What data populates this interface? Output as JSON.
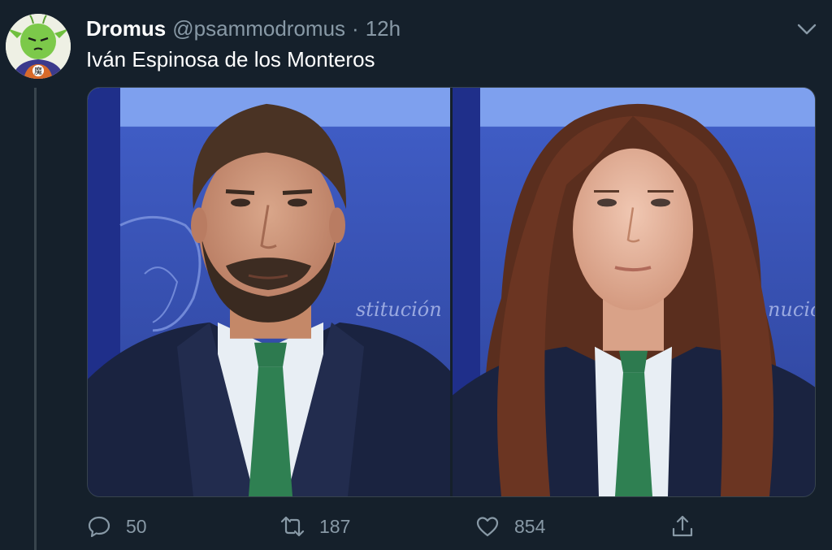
{
  "tweet": {
    "display_name": "Dromus",
    "handle": "@psammodromus",
    "separator": "·",
    "time": "12h",
    "text": "Iván Espinosa de los Monteros"
  },
  "media": {
    "photos": [
      {
        "name": "original-photo"
      },
      {
        "name": "edited-photo"
      }
    ]
  },
  "actions": {
    "reply_count": "50",
    "retweet_count": "187",
    "like_count": "854"
  },
  "icons": {
    "reply": "speech-bubble-icon",
    "retweet": "retweet-icon",
    "like": "heart-icon",
    "share": "share-icon",
    "menu": "chevron-down-icon"
  },
  "colors": {
    "background": "#15202b",
    "secondary_text": "#8899a6",
    "border": "#38444d",
    "tie_green": "#2f7a52",
    "backdrop_blue": "#2f4aa8"
  }
}
